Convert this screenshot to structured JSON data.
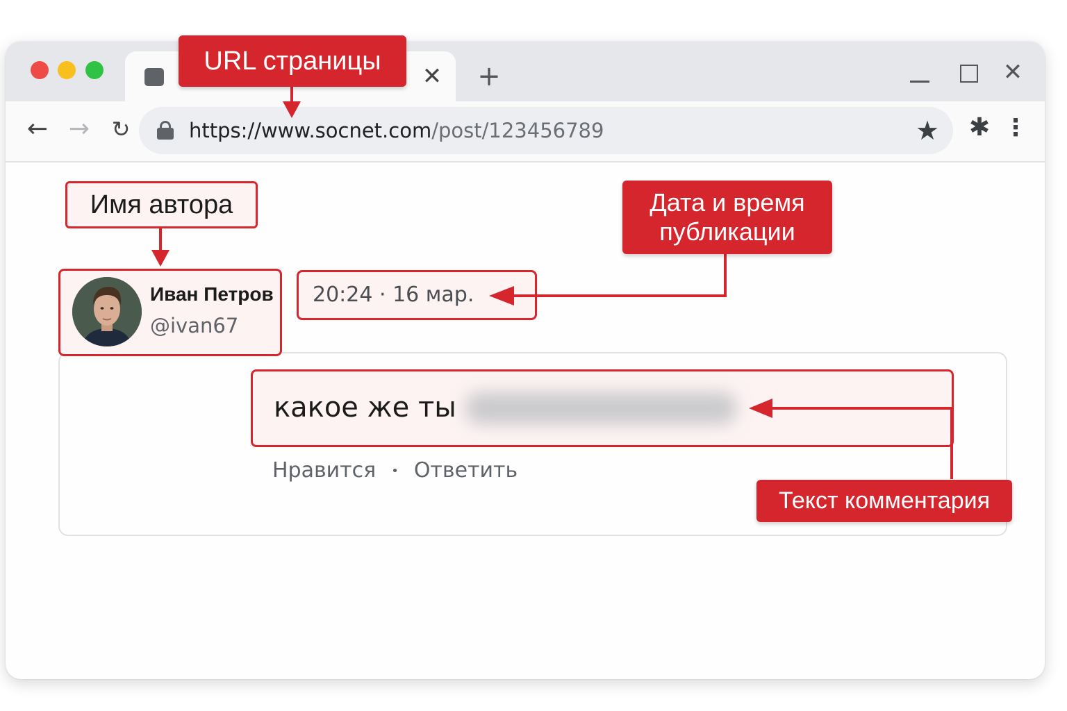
{
  "browser": {
    "tab_close_glyph": "✕",
    "new_tab_glyph": "+",
    "window_close_glyph": "✕",
    "url_host": "https://www.socnet.com",
    "url_path": "/post/123456789",
    "nav": {
      "back_glyph": "←",
      "forward_glyph": "→",
      "reload_glyph": "↻"
    },
    "icons": {
      "star": "★",
      "extension": "✱",
      "menu": "⋮"
    }
  },
  "post": {
    "author_name": "Иван Петров",
    "author_handle": "@ivan67",
    "date": "20:24 · 16 мар.",
    "comment_visible": "какое же ты",
    "actions": {
      "like": "Нравится",
      "separator": "•",
      "reply": "Ответить"
    }
  },
  "annotations": {
    "url": "URL страницы",
    "author": "Имя автора",
    "date_line1": "Дата и время",
    "date_line2": "публикации",
    "comment": "Текст комментария"
  },
  "colors": {
    "accent": "#d6262d",
    "traffic_red": "#ee4b47",
    "traffic_yellow": "#f7c01f",
    "traffic_green": "#2fc243"
  }
}
